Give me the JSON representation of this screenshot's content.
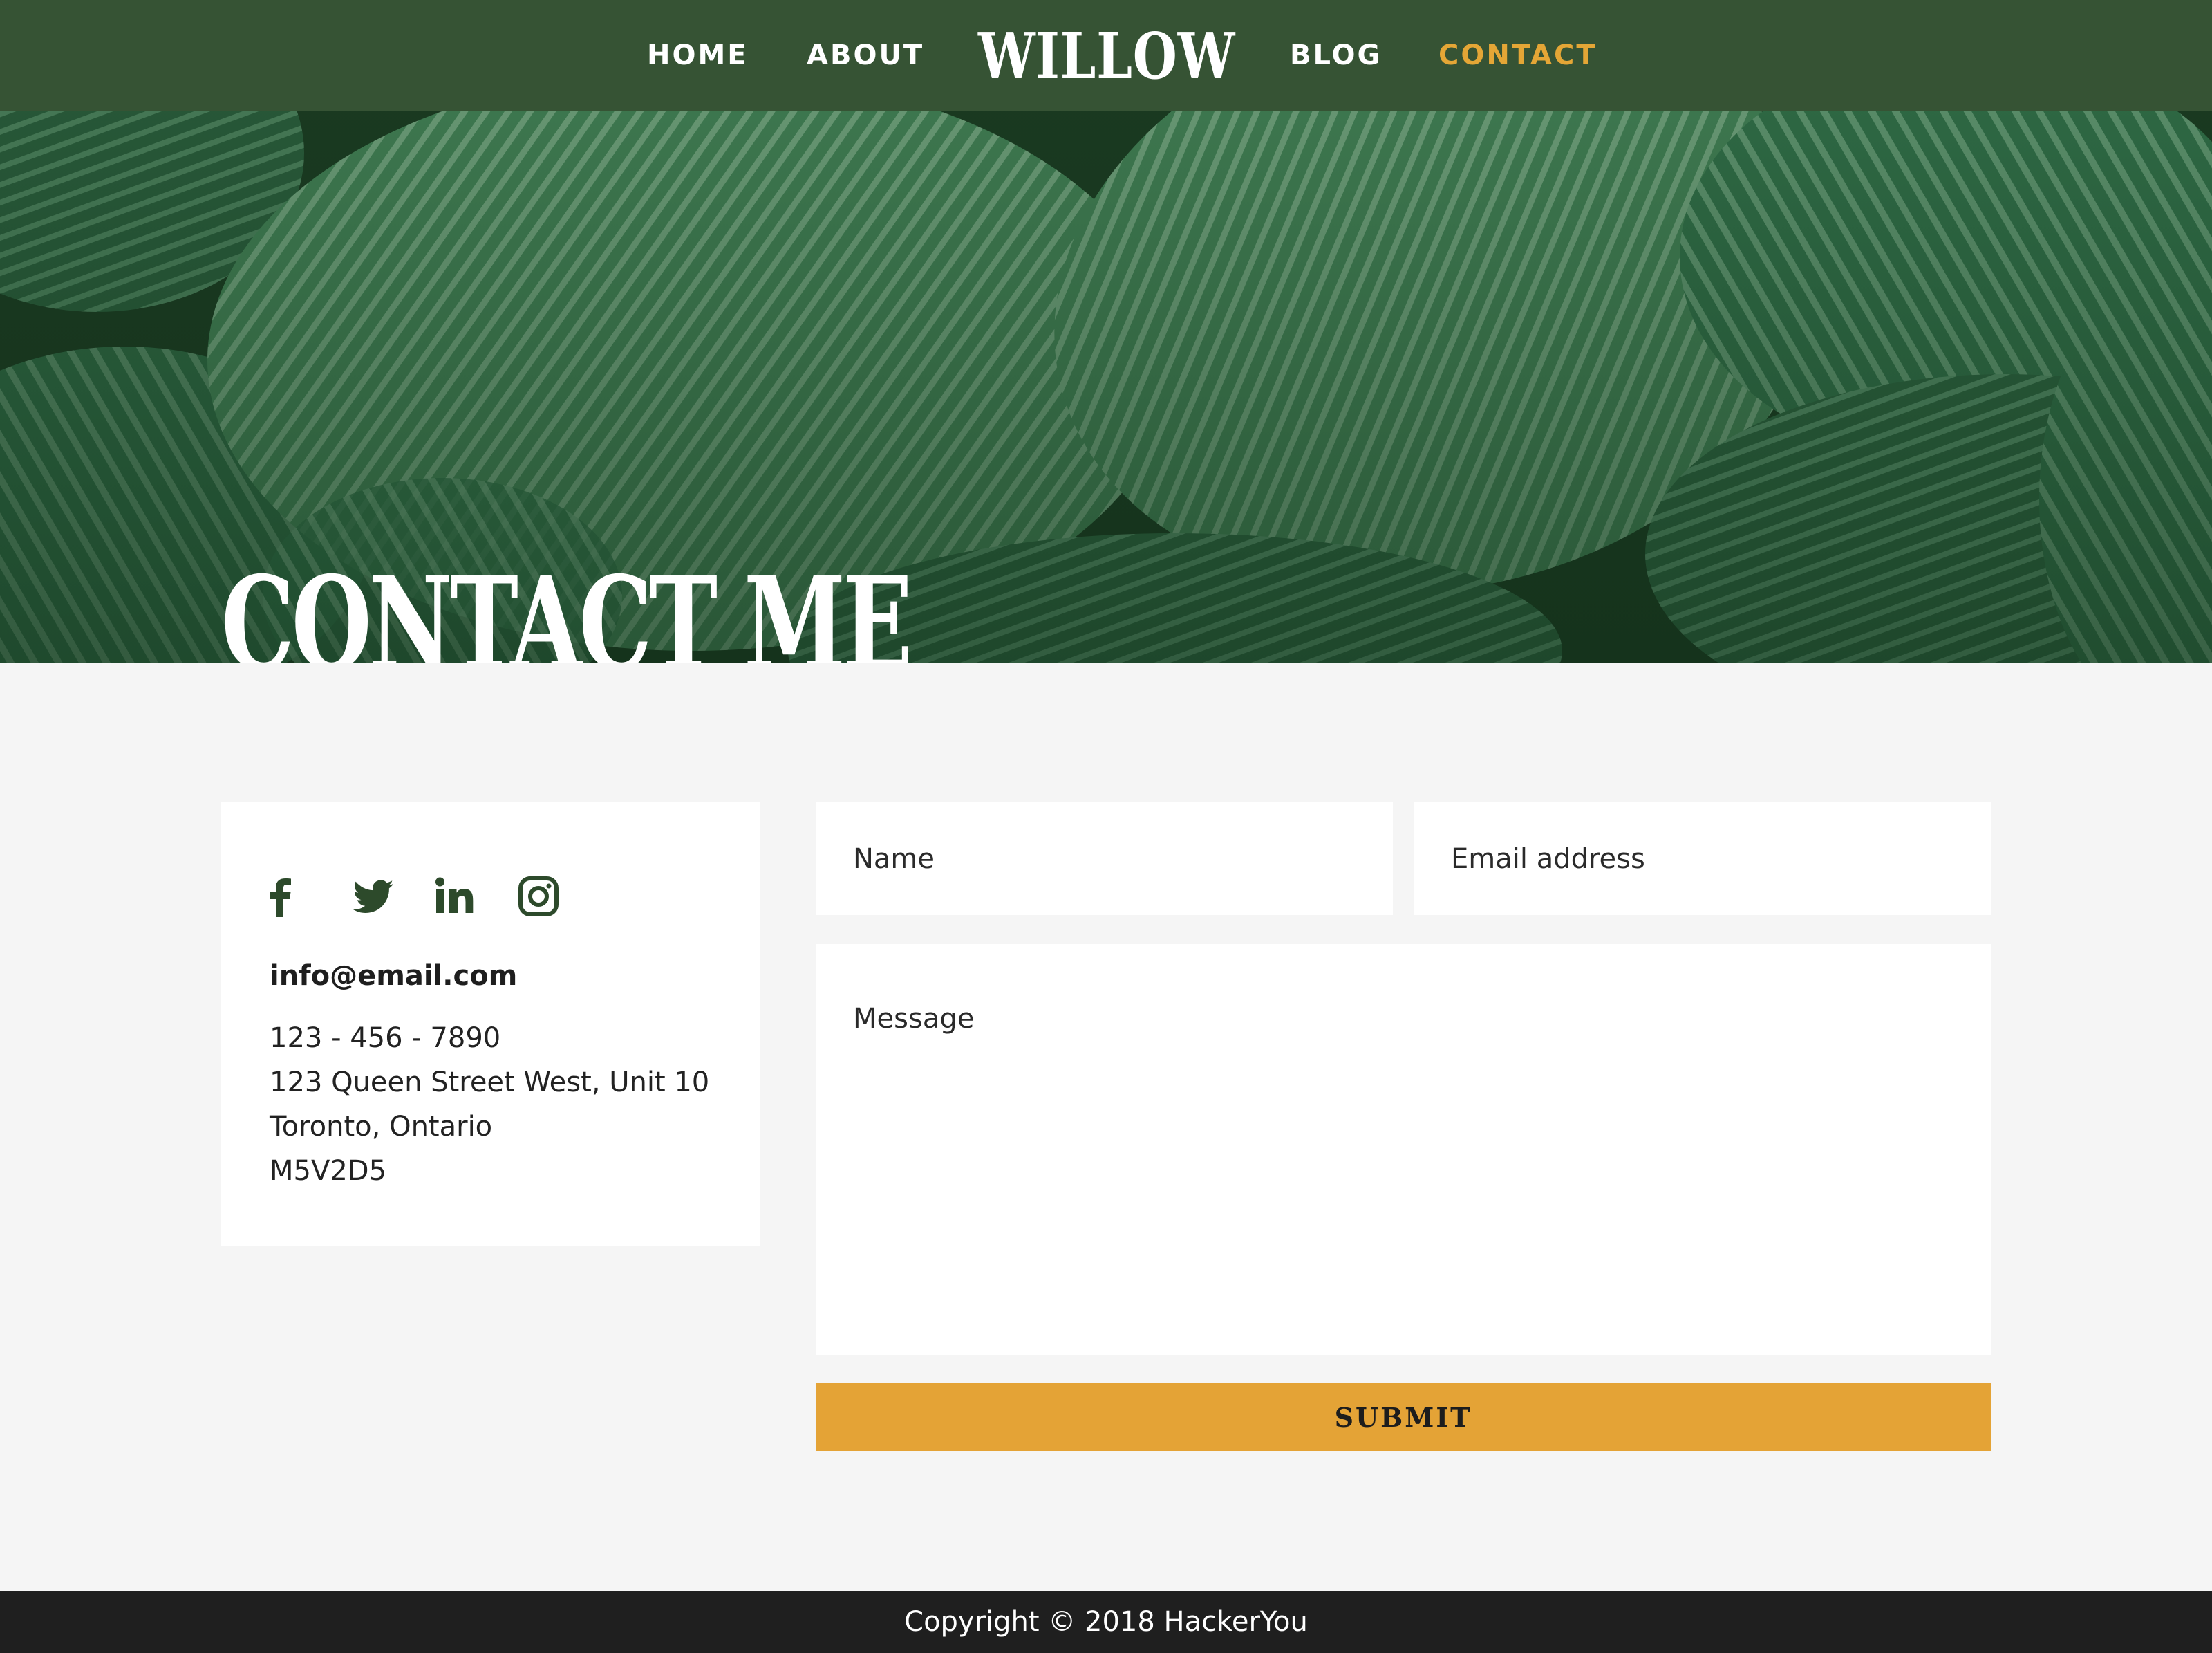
{
  "nav": {
    "home": "HOME",
    "about": "ABOUT",
    "logo": "WILLOW",
    "blog": "BLOG",
    "contact": "CONTACT"
  },
  "hero": {
    "title": "CONTACT ME"
  },
  "contact_card": {
    "social_icons": [
      "facebook-icon",
      "twitter-icon",
      "linkedin-icon",
      "instagram-icon"
    ],
    "email": "info@email.com",
    "phone": "123 - 456 - 7890",
    "address_line1": "123 Queen Street West, Unit 10",
    "address_line2": "Toronto, Ontario",
    "postal_code": "M5V2D5"
  },
  "form": {
    "name_placeholder": "Name",
    "email_placeholder": "Email address",
    "message_placeholder": "Message",
    "submit_label": "SUBMIT"
  },
  "footer": {
    "copyright": "Copyright © 2018 HackerYou"
  },
  "colors": {
    "nav_bg": "#365334",
    "accent": "#e4a336",
    "page_bg": "#f5f5f5",
    "footer_bg": "#1f1f1f",
    "icon_green": "#2d4a2b"
  }
}
